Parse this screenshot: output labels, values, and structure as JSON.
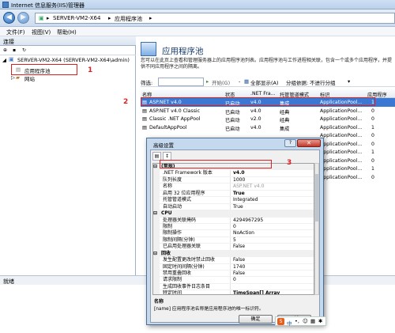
{
  "window": {
    "title": "Internet 信息服务(IIS)管理器"
  },
  "address": {
    "part1": "SERVER-VM2-X64",
    "part2": "应用程序池"
  },
  "menu": [
    "文件(F)",
    "视图(V)",
    "帮助(H)"
  ],
  "left": {
    "header": "连接",
    "tree": [
      {
        "label": "SERVER-VM2-X64 (SERVER-VM2-X64\\admin)"
      },
      {
        "label": "应用程序池"
      },
      {
        "label": "网站"
      }
    ]
  },
  "main": {
    "title": "应用程序池",
    "desc": "您可以在此页上查看和管理服务器上的应用程序池列表。应用程序池与工作进程相关联，包含一个或多个应用程序，并提供不同应用程序之间的隔离。",
    "filter_label": "筛选:",
    "go_label": "开始(G)",
    "showall_label": "全部显示(A)",
    "group_label": "分组依据:",
    "group_value": "不进行分组",
    "columns": [
      "名称",
      "状态",
      ".NET Fra...",
      "托管管道模式",
      "标识",
      "应用程序"
    ],
    "rows": [
      [
        "ASP.NET v4.0",
        "已启动",
        "v4.0",
        "集成",
        "ApplicationPool...",
        "1"
      ],
      [
        "ASP.NET v4.0 Classic",
        "已启动",
        "v4.0",
        "经典",
        "ApplicationPool...",
        "0"
      ],
      [
        "Classic .NET AppPool",
        "已启动",
        "v2.0",
        "经典",
        "ApplicationPool...",
        "0"
      ],
      [
        "DefaultAppPool",
        "已启动",
        "v4.0",
        "集成",
        "ApplicationPool...",
        "1"
      ],
      [
        "",
        "",
        "",
        "",
        "ApplicationPool...",
        "0"
      ],
      [
        "",
        "",
        "",
        "",
        "ApplicationPool...",
        "0"
      ],
      [
        "",
        "",
        "",
        "",
        "ApplicationPool...",
        "1"
      ],
      [
        "",
        "",
        "",
        "",
        "ApplicationPool...",
        "0"
      ],
      [
        "",
        "",
        "",
        "",
        "ApplicationPool...",
        "1"
      ],
      [
        "",
        "",
        "",
        "",
        "ApplicationPool...",
        "0"
      ]
    ]
  },
  "status": "就绪",
  "dialog": {
    "title": "高级设置",
    "props": [
      {
        "cat": true,
        "name": "(常规)"
      },
      {
        "name": ".NET Framework 版本",
        "value": "v4.0",
        "bold": true
      },
      {
        "name": "队列长度",
        "value": "1000"
      },
      {
        "name": "名称",
        "value": "ASP.NET v4.0",
        "grey": true
      },
      {
        "name": "启用 32 位应用程序",
        "value": "True",
        "bold": true
      },
      {
        "name": "托管管道模式",
        "value": "Integrated"
      },
      {
        "name": "自动启动",
        "value": "True"
      },
      {
        "cat": true,
        "name": "CPU"
      },
      {
        "name": "处理器关联掩码",
        "value": "4294967295"
      },
      {
        "name": "限制",
        "value": "0"
      },
      {
        "name": "限制操作",
        "value": "NoAction"
      },
      {
        "name": "限制间隔(分钟)",
        "value": "5"
      },
      {
        "name": "已启用处理器关联",
        "value": "False"
      },
      {
        "cat": true,
        "name": "回收"
      },
      {
        "name": "发生配置更改时禁止回收",
        "value": "False"
      },
      {
        "name": "固定时间间隔(分钟)",
        "value": "1740"
      },
      {
        "name": "禁用重叠回收",
        "value": "False"
      },
      {
        "name": "请求限制",
        "value": "0"
      },
      {
        "name": "生成回收事件日志条目",
        "value": ""
      },
      {
        "name": "特定时间",
        "value": "TimeSpan[] Array",
        "bold": true
      }
    ],
    "desc_title": "名称",
    "desc_text": "[name] 应用程序池名称是应用程序池的唯一标识符。",
    "ok_label": "确定",
    "cancel_label": "取消"
  },
  "annotations": [
    "1",
    "2",
    "3"
  ],
  "ime_text": "中"
}
